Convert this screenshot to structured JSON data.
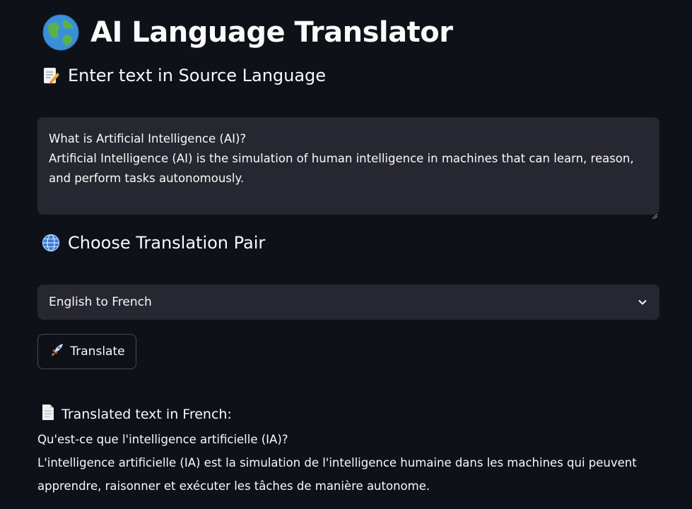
{
  "app": {
    "title": "AI Language Translator",
    "title_icon": "globe-earth-emoji"
  },
  "source_section": {
    "header": "Enter text in Source Language",
    "header_icon": "memo-pencil-emoji",
    "text_lines": [
      "What is Artificial Intelligence (AI)?",
      "Artificial Intelligence (AI) is the simulation of human intelligence in machines that can learn, reason,",
      "and perform tasks autonomously."
    ]
  },
  "pair_section": {
    "header": "Choose Translation Pair",
    "header_icon": "globe-meridians-emoji",
    "selected": "English to French"
  },
  "translate_button": {
    "label": "Translate",
    "icon": "rocket-emoji"
  },
  "result": {
    "header": "Translated text in French:",
    "header_icon": "page-document-emoji",
    "lines": [
      "Qu'est-ce que l'intelligence artificielle (IA)?",
      "L'intelligence artificielle (IA) est la simulation de l'intelligence humaine dans les machines qui peuvent",
      "apprendre, raisonner et exécuter les tâches de manière autonome."
    ]
  },
  "colors": {
    "background": "#0e1117",
    "input_bg": "#262730",
    "text": "#fafafa"
  }
}
